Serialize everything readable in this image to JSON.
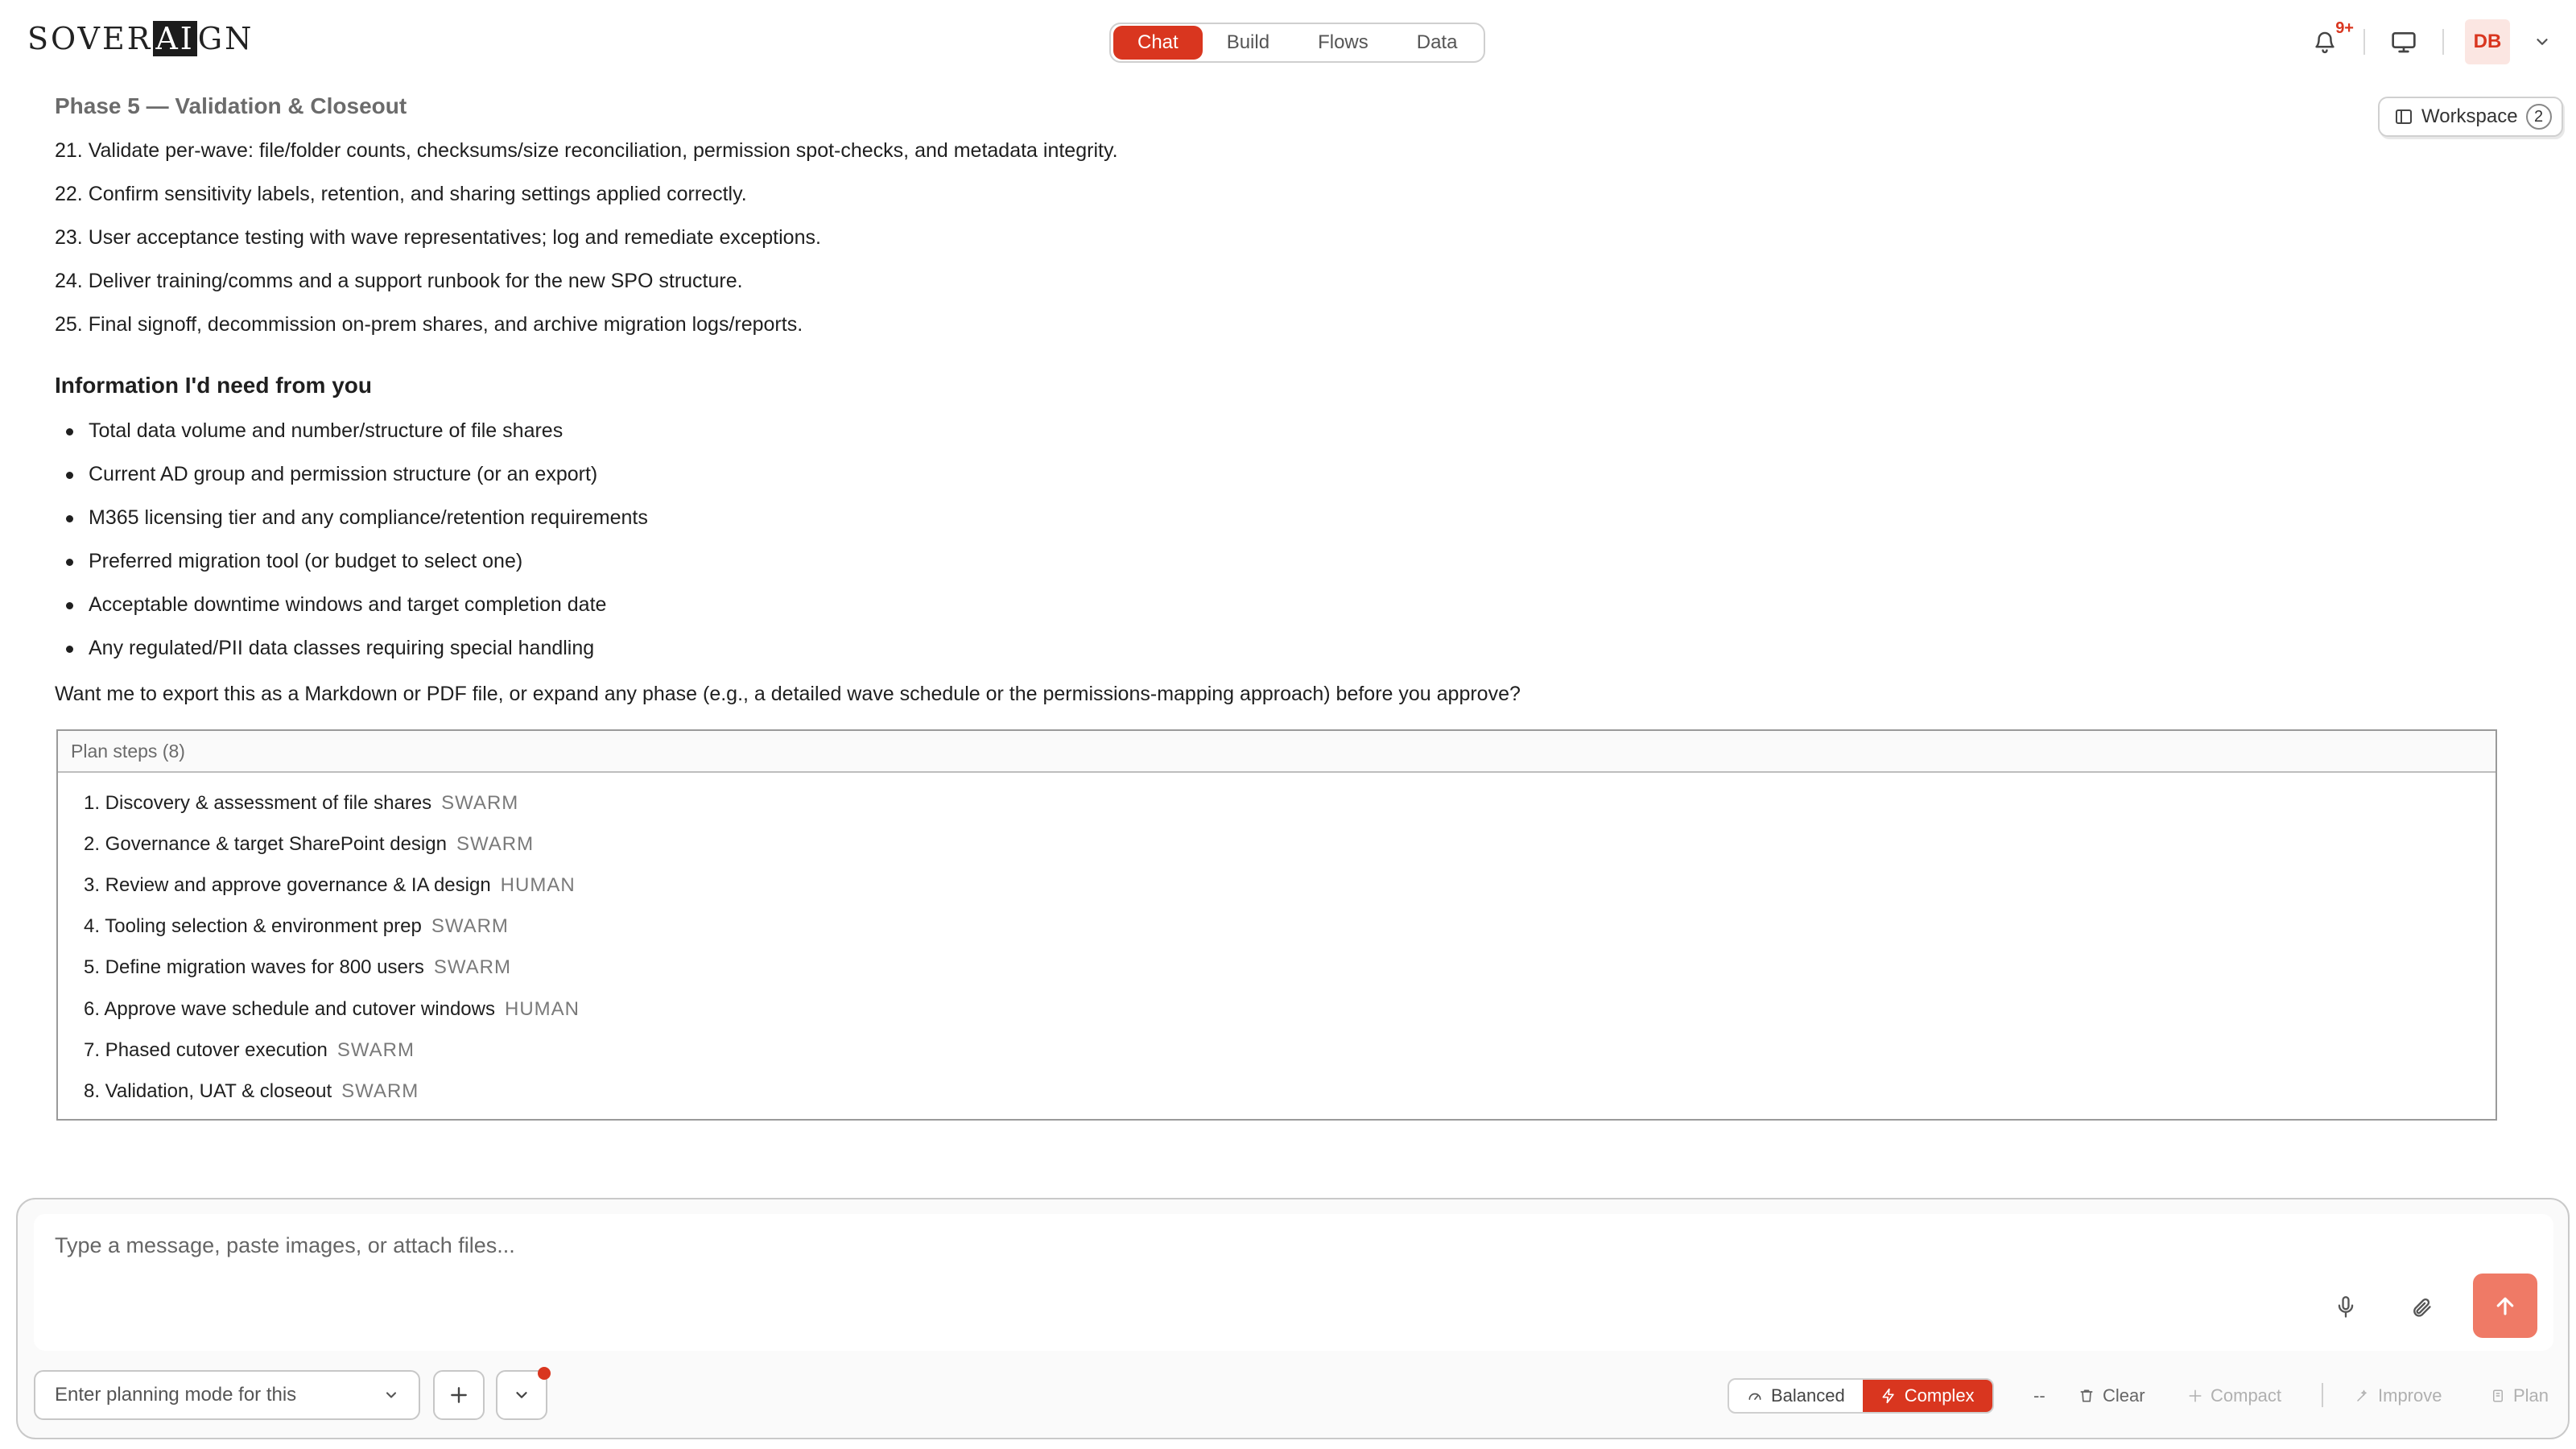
{
  "app": {
    "logo_pre": "SOVER",
    "logo_ai": "AI",
    "logo_post": "GN"
  },
  "nav": {
    "tabs": [
      {
        "label": "Chat",
        "active": true
      },
      {
        "label": "Build",
        "active": false
      },
      {
        "label": "Flows",
        "active": false
      },
      {
        "label": "Data",
        "active": false
      }
    ]
  },
  "header": {
    "notifications_badge": "9+",
    "avatar_initials": "DB"
  },
  "workspace": {
    "label": "Workspace",
    "count": "2"
  },
  "message": {
    "phase_title": "Phase 5 — Validation & Closeout",
    "numbered": [
      "21. Validate per-wave: file/folder counts, checksums/size reconciliation, permission spot-checks, and metadata integrity.",
      "22. Confirm sensitivity labels, retention, and sharing settings applied correctly.",
      "23. User acceptance testing with wave representatives; log and remediate exceptions.",
      "24. Deliver training/comms and a support runbook for the new SPO structure.",
      "25. Final signoff, decommission on-prem shares, and archive migration logs/reports."
    ],
    "info_title": "Information I'd need from you",
    "bullets": [
      "Total data volume and number/structure of file shares",
      "Current AD group and permission structure (or an export)",
      "M365 licensing tier and any compliance/retention requirements",
      "Preferred migration tool (or budget to select one)",
      "Acceptable downtime windows and target completion date",
      "Any regulated/PII data classes requiring special handling"
    ],
    "closing": "Want me to export this as a Markdown or PDF file, or expand any phase (e.g., a detailed wave schedule or the permissions-mapping approach) before you approve?"
  },
  "plan": {
    "title": "Plan steps (8)",
    "steps": [
      {
        "label": "1. Discovery & assessment of file shares",
        "tag": "SWARM"
      },
      {
        "label": "2. Governance & target SharePoint design",
        "tag": "SWARM"
      },
      {
        "label": "3. Review and approve governance & IA design",
        "tag": "HUMAN"
      },
      {
        "label": "4. Tooling selection & environment prep",
        "tag": "SWARM"
      },
      {
        "label": "5. Define migration waves for 800 users",
        "tag": "SWARM"
      },
      {
        "label": "6. Approve wave schedule and cutover windows",
        "tag": "HUMAN"
      },
      {
        "label": "7. Phased cutover execution",
        "tag": "SWARM"
      },
      {
        "label": "8. Validation, UAT & closeout",
        "tag": "SWARM"
      }
    ]
  },
  "composer": {
    "placeholder": "Type a message, paste images, or attach files...",
    "planning_select": "Enter planning mode for this",
    "mode_balanced": "Balanced",
    "mode_complex": "Complex",
    "dash": "--",
    "clear": "Clear",
    "compact": "Compact",
    "improve": "Improve",
    "plan": "Plan"
  },
  "colors": {
    "accent": "#d9361f",
    "send": "#ef7a66"
  }
}
